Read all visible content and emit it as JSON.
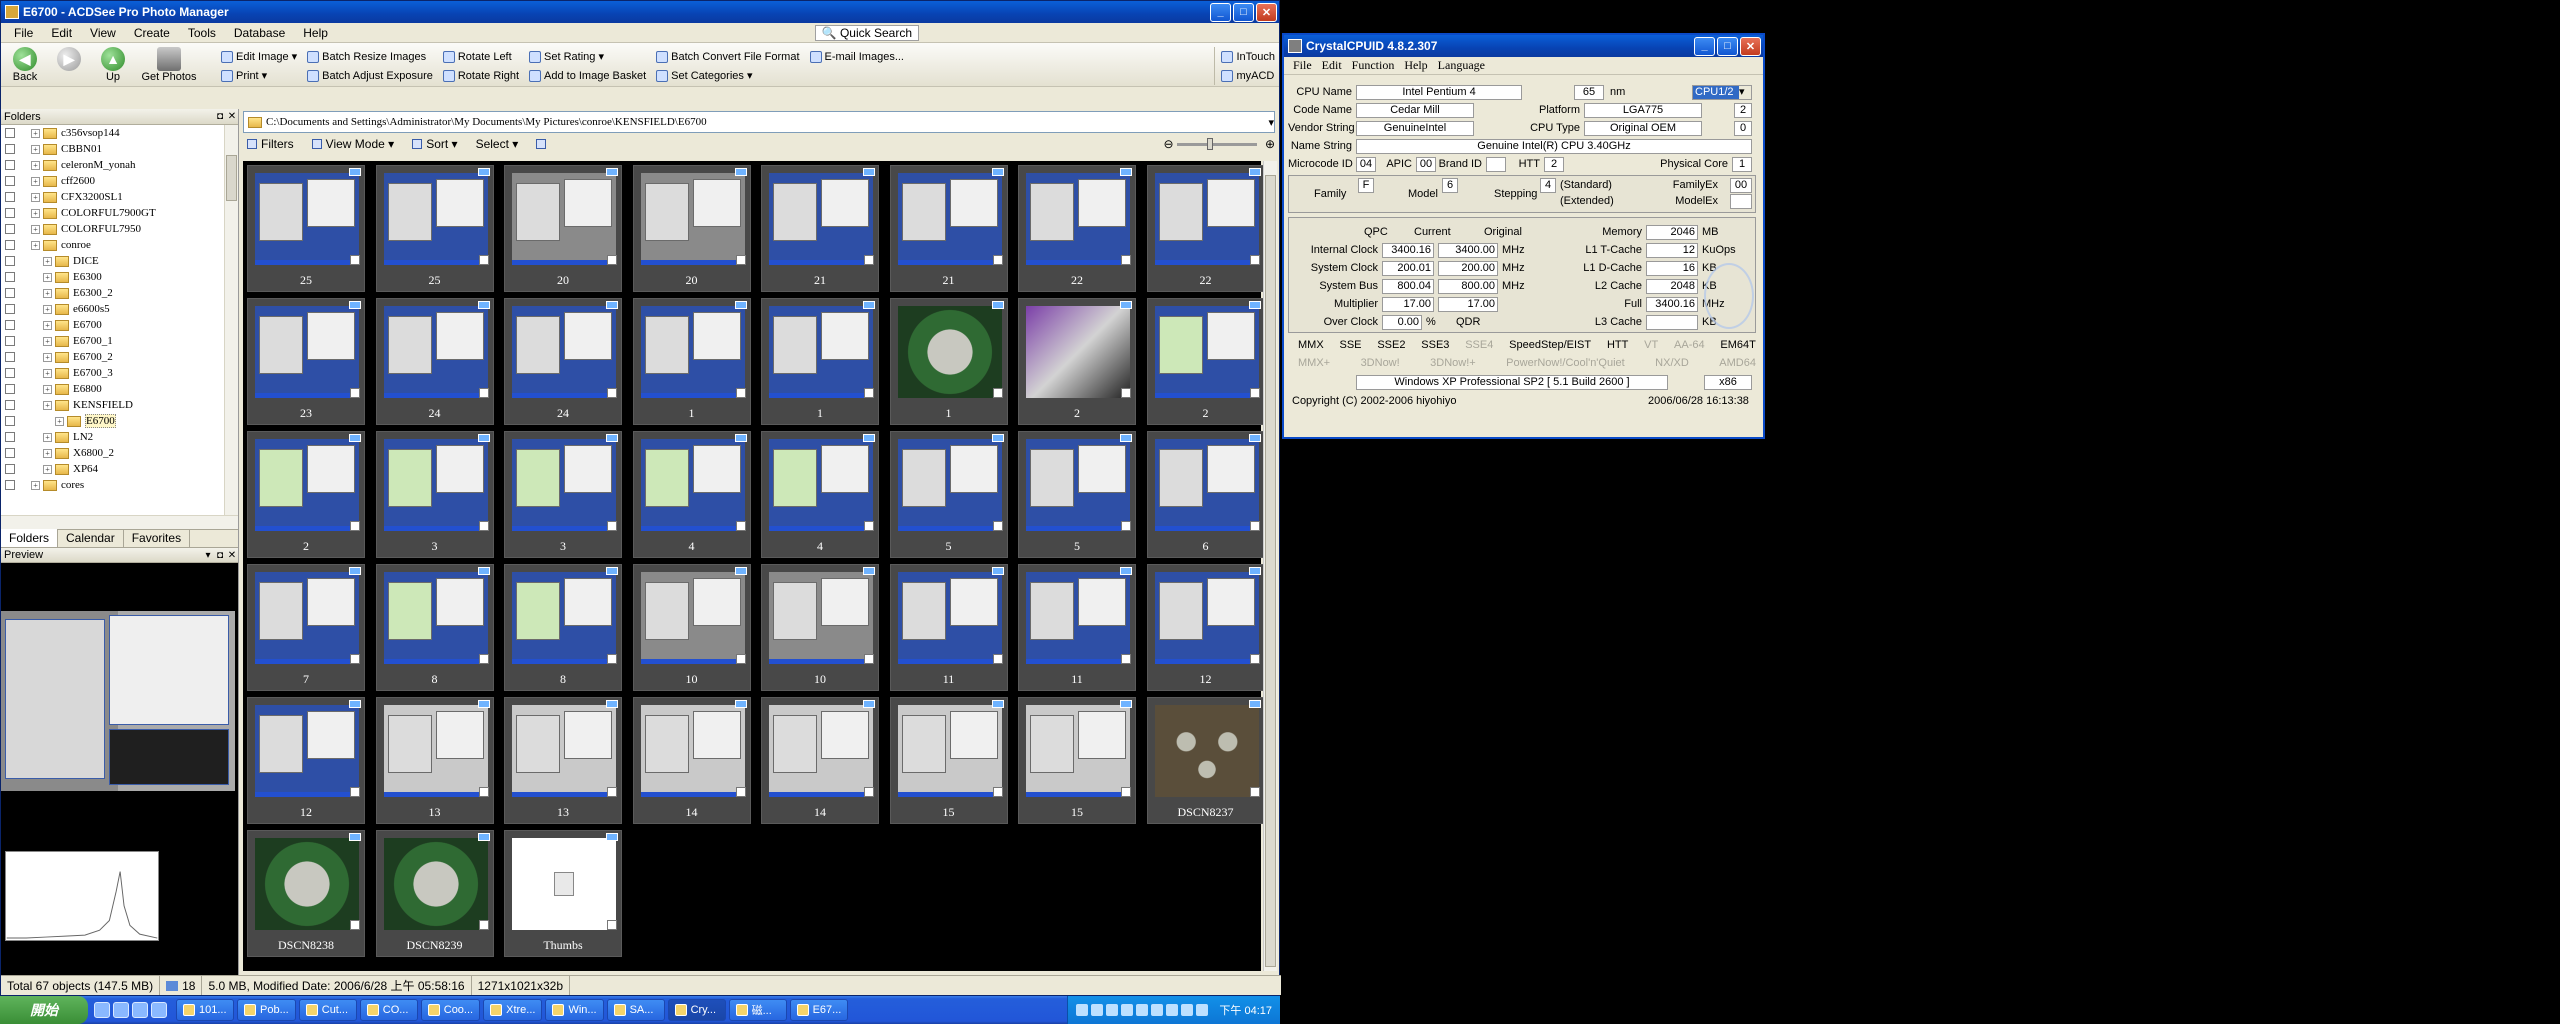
{
  "acdsee": {
    "title": "E6700 - ACDSee Pro Photo Manager",
    "menu": [
      "File",
      "Edit",
      "View",
      "Create",
      "Tools",
      "Database",
      "Help"
    ],
    "quick_search": "Quick Search",
    "toolbar": {
      "back": "Back",
      "forward": "",
      "up": "Up",
      "get_photos": "Get Photos",
      "edit_image": "Edit Image",
      "print": "Print",
      "batch_resize": "Batch Resize Images",
      "batch_adjust": "Batch Adjust Exposure",
      "rotate_left": "Rotate Left",
      "rotate_right": "Rotate Right",
      "set_rating": "Set Rating",
      "add_basket": "Add to Image Basket",
      "batch_convert": "Batch Convert File Format",
      "set_categories": "Set Categories",
      "email": "E-mail Images...",
      "intouch": "InTouch",
      "myacd": "myACD"
    },
    "folders_title": "Folders",
    "tree": [
      {
        "label": "c356vsop144",
        "indent": 1
      },
      {
        "label": "CBBN01",
        "indent": 1
      },
      {
        "label": "celeronM_yonah",
        "indent": 1
      },
      {
        "label": "cff2600",
        "indent": 1
      },
      {
        "label": "CFX3200SL1",
        "indent": 1
      },
      {
        "label": "COLORFUL7900GT",
        "indent": 1
      },
      {
        "label": "COLORFUL7950",
        "indent": 1
      },
      {
        "label": "conroe",
        "indent": 1
      },
      {
        "label": "DICE",
        "indent": 2
      },
      {
        "label": "E6300",
        "indent": 2
      },
      {
        "label": "E6300_2",
        "indent": 2
      },
      {
        "label": "e6600s5",
        "indent": 2
      },
      {
        "label": "E6700",
        "indent": 2
      },
      {
        "label": "E6700_1",
        "indent": 2
      },
      {
        "label": "E6700_2",
        "indent": 2
      },
      {
        "label": "E6700_3",
        "indent": 2
      },
      {
        "label": "E6800",
        "indent": 2
      },
      {
        "label": "KENSFIELD",
        "indent": 2
      },
      {
        "label": "E6700",
        "indent": 3,
        "selected": true
      },
      {
        "label": "LN2",
        "indent": 2
      },
      {
        "label": "X6800_2",
        "indent": 2
      },
      {
        "label": "XP64",
        "indent": 2
      },
      {
        "label": "cores",
        "indent": 1
      }
    ],
    "pane_tabs": [
      "Folders",
      "Calendar",
      "Favorites"
    ],
    "preview_title": "Preview",
    "path": "C:\\Documents and Settings\\Administrator\\My Documents\\My Pictures\\conroe\\KENSFIELD\\E6700",
    "subbar": {
      "filters": "Filters",
      "view_mode": "View Mode",
      "sort": "Sort",
      "select": "Select"
    },
    "thumbnails": [
      {
        "caption": "25",
        "style": "blue"
      },
      {
        "caption": "25",
        "style": "blue"
      },
      {
        "caption": "20",
        "style": "grey"
      },
      {
        "caption": "20",
        "style": "grey"
      },
      {
        "caption": "21",
        "style": "blue"
      },
      {
        "caption": "21",
        "style": "blue"
      },
      {
        "caption": "22",
        "style": "blue"
      },
      {
        "caption": "22",
        "style": "blue"
      },
      {
        "caption": "23",
        "style": "blue"
      },
      {
        "caption": "24",
        "style": "blue"
      },
      {
        "caption": "24",
        "style": "blue"
      },
      {
        "caption": "1",
        "style": "blue"
      },
      {
        "caption": "1",
        "style": "blue"
      },
      {
        "caption": "1",
        "style": "photo"
      },
      {
        "caption": "2",
        "style": "multi"
      },
      {
        "caption": "2",
        "style": "green"
      },
      {
        "caption": "2",
        "style": "green"
      },
      {
        "caption": "3",
        "style": "green"
      },
      {
        "caption": "3",
        "style": "green"
      },
      {
        "caption": "4",
        "style": "green"
      },
      {
        "caption": "4",
        "style": "green"
      },
      {
        "caption": "5",
        "style": "blue"
      },
      {
        "caption": "5",
        "style": "blue"
      },
      {
        "caption": "6",
        "style": "blue"
      },
      {
        "caption": "7",
        "style": "blue"
      },
      {
        "caption": "8",
        "style": "green"
      },
      {
        "caption": "8",
        "style": "green"
      },
      {
        "caption": "10",
        "style": "grey"
      },
      {
        "caption": "10",
        "style": "grey"
      },
      {
        "caption": "11",
        "style": "blue"
      },
      {
        "caption": "11",
        "style": "blue"
      },
      {
        "caption": "12",
        "style": "blue"
      },
      {
        "caption": "12",
        "style": "blue"
      },
      {
        "caption": "13",
        "style": "white"
      },
      {
        "caption": "13",
        "style": "white"
      },
      {
        "caption": "14",
        "style": "white"
      },
      {
        "caption": "14",
        "style": "white"
      },
      {
        "caption": "15",
        "style": "white"
      },
      {
        "caption": "15",
        "style": "white"
      },
      {
        "caption": "DSCN8237",
        "style": "photo5"
      },
      {
        "caption": "DSCN8238",
        "style": "photo"
      },
      {
        "caption": "DSCN8239",
        "style": "photo"
      },
      {
        "caption": "Thumbs",
        "style": "thumbs"
      }
    ],
    "status": {
      "total": "Total 67 objects  (147.5 MB)",
      "selected": "18",
      "info": "5.0 MB, Modified Date: 2006/6/28 上午 05:58:16",
      "dims": "1271x1021x32b"
    }
  },
  "crystal": {
    "title": "CrystalCPUID 4.8.2.307",
    "menu": [
      "File",
      "Edit",
      "Function",
      "Help",
      "Language"
    ],
    "cpu_name_label": "CPU Name",
    "cpu_name": "Intel Pentium 4",
    "process": "65",
    "nm": "nm",
    "cpu_select": "CPU1/2",
    "code_name_label": "Code Name",
    "code_name": "Cedar Mill",
    "platform_label": "Platform",
    "platform": "LGA775",
    "platform_n": "2",
    "vendor_label": "Vendor String",
    "vendor": "GenuineIntel",
    "cpu_type_label": "CPU Type",
    "cpu_type": "Original OEM",
    "cpu_type_n": "0",
    "name_string_label": "Name String",
    "name_string": "Genuine Intel(R) CPU 3.40GHz",
    "microcode_label": "Microcode ID",
    "microcode": "04",
    "apic_label": "APIC",
    "apic": "00",
    "brand_label": "Brand ID",
    "brand": "",
    "htt_label": "HTT",
    "htt": "2",
    "pcore_label": "Physical Core",
    "pcore": "1",
    "family_label": "Family",
    "family": "F",
    "model_label": "Model",
    "model": "6",
    "stepping_label": "Stepping",
    "stepping": "4",
    "standard": "(Standard)",
    "extended": "(Extended)",
    "familyex_label": "FamilyEx",
    "familyex": "00",
    "modelex_label": "ModelEx",
    "modelex": "",
    "qpc": "QPC",
    "current": "Current",
    "original": "Original",
    "internal_clock_label": "Internal Clock",
    "internal_cur": "3400.16",
    "internal_orig": "3400.00",
    "mhz": "MHz",
    "system_clock_label": "System Clock",
    "system_cur": "200.01",
    "system_orig": "200.00",
    "system_bus_label": "System Bus",
    "bus_cur": "800.04",
    "bus_orig": "800.00",
    "multiplier_label": "Multiplier",
    "mult_cur": "17.00",
    "mult_orig": "17.00",
    "overclock_label": "Over Clock",
    "overclock": "0.00",
    "pct": "%",
    "qdr": "QDR",
    "memory_label": "Memory",
    "memory": "2046",
    "mb": "MB",
    "l1t_label": "L1 T-Cache",
    "l1t": "12",
    "kuops": "KuOps",
    "l1d_label": "L1 D-Cache",
    "l1d": "16",
    "kb": "KB",
    "l2_label": "L2 Cache",
    "l2": "2048",
    "full_label": "Full",
    "full": "3400.16",
    "l3_label": "L3 Cache",
    "l3": "",
    "features1": [
      "MMX",
      "SSE",
      "SSE2",
      "SSE3",
      "SSE4",
      "SpeedStep/EIST",
      "HTT",
      "VT",
      "AA-64",
      "EM64T"
    ],
    "features2": [
      "MMX+",
      "3DNow!",
      "3DNow!+",
      "PowerNow!/Cool'n'Quiet",
      "NX/XD",
      "AMD64"
    ],
    "os": "Windows XP Professional SP2 [ 5.1 Build 2600 ]",
    "arch": "x86",
    "copyright": "Copyright (C) 2002-2006 hiyohiyo",
    "date": "2006/06/28 16:13:38"
  },
  "taskbar": {
    "start": "開始",
    "buttons": [
      "101...",
      "Pob...",
      "Cut...",
      "CO...",
      "Coo...",
      "Xtre...",
      "Win...",
      "SA...",
      "Cry...",
      "磁...",
      "E67..."
    ],
    "active_index": 8,
    "clock": "下午 04:17"
  }
}
